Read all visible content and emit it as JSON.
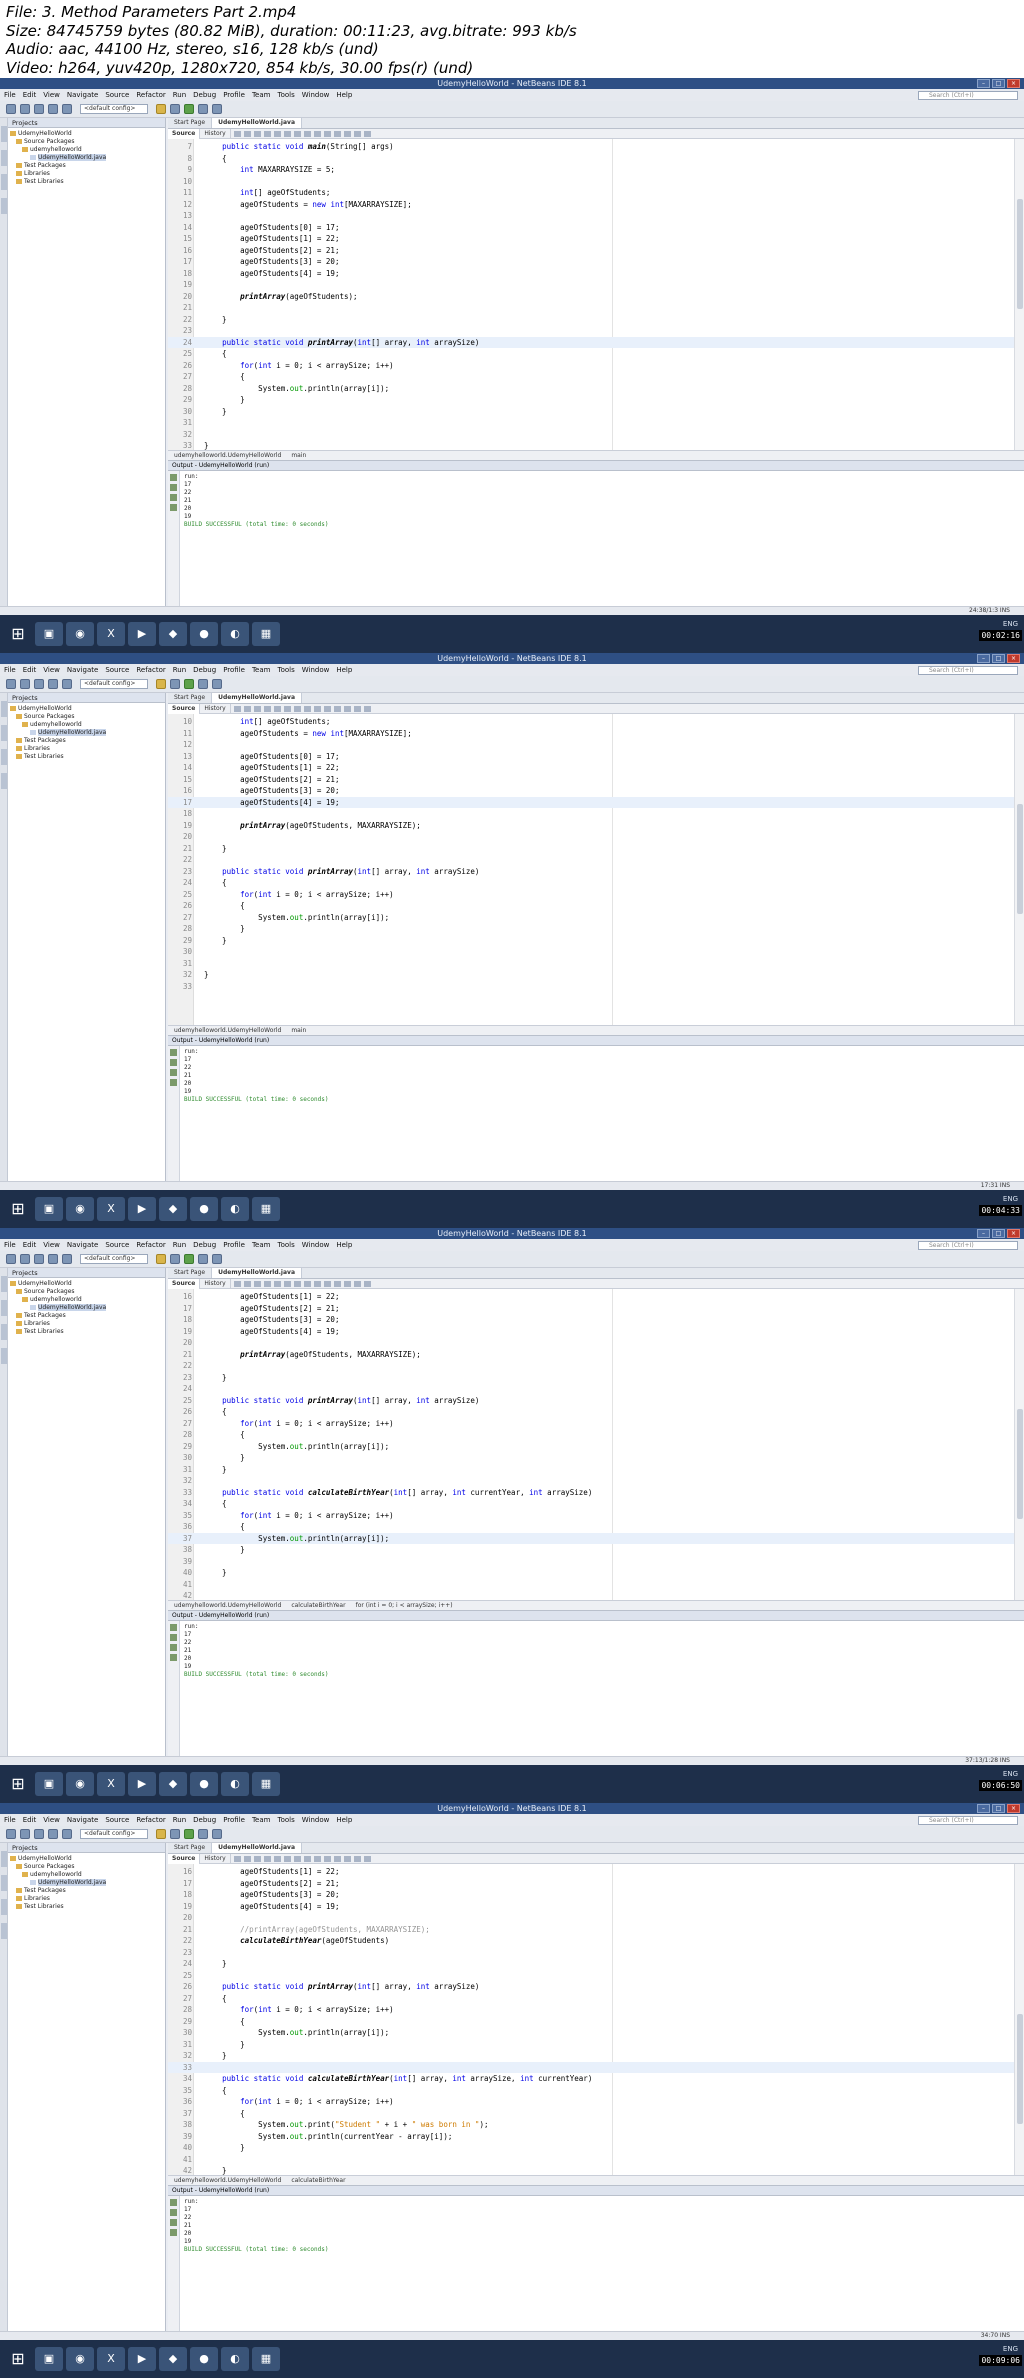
{
  "header": {
    "file_line": "File: 3. Method Parameters Part 2.mp4",
    "size_line": "Size: 84745759 bytes (80.82 MiB), duration: 00:11:23, avg.bitrate: 993 kb/s",
    "audio_line": "Audio: aac, 44100 Hz, stereo, s16, 128 kb/s (und)",
    "video_line": "Video: h264, yuv420p, 1280x720, 854 kb/s, 30.00 fps(r) (und)"
  },
  "ide": {
    "window_title": "UdemyHelloWorld - NetBeans IDE 8.1",
    "menu": [
      "File",
      "Edit",
      "View",
      "Navigate",
      "Source",
      "Refactor",
      "Run",
      "Debug",
      "Profile",
      "Team",
      "Tools",
      "Window",
      "Help"
    ],
    "search_placeholder": "Search (Ctrl+I)",
    "config": "<default config>",
    "projects_tab": "Projects",
    "tree": [
      "UdemyHelloWorld",
      "Source Packages",
      "udemyhelloworld",
      "UdemyHelloWorld.java",
      "Test Packages",
      "Libraries",
      "Test Libraries"
    ],
    "editor_tabs": [
      "Start Page",
      "UdemyHelloWorld.java"
    ],
    "source_btn": "Source",
    "history_btn": "History",
    "output_tab": "Output - UdemyHelloWorld (run)",
    "taskbar_apps": [
      "⊞",
      "▣",
      "◉",
      "X",
      "▶",
      "◆",
      "●",
      "◐",
      "▦"
    ],
    "tray_lang": "ENG"
  },
  "frames": [
    {
      "timestamp": "00:02:16",
      "first_line_no": 7,
      "highlight_line": 24,
      "lines": [
        "    public static void main(String[] args)",
        "    {",
        "        int MAXARRAYSIZE = 5;",
        "",
        "        int[] ageOfStudents;",
        "        ageOfStudents = new int[MAXARRAYSIZE];",
        "",
        "        ageOfStudents[0] = 17;",
        "        ageOfStudents[1] = 22;",
        "        ageOfStudents[2] = 21;",
        "        ageOfStudents[3] = 20;",
        "        ageOfStudents[4] = 19;",
        "",
        "        printArray(ageOfStudents);",
        "",
        "    }",
        "",
        "    public static void printArray(int[] array, int arraySize)",
        "    {",
        "        for(int i = 0; i < arraySize; i++)",
        "        {",
        "            System.out.println(array[i]);",
        "        }",
        "    }",
        "",
        "",
        "}",
        ""
      ],
      "nav": [
        "udemyhelloworld.UdemyHelloWorld",
        "main"
      ],
      "output": [
        "run:",
        "17",
        "22",
        "21",
        "20",
        "19",
        "BUILD SUCCESSFUL (total time: 0 seconds)"
      ],
      "status": "24:38/1:3  INS"
    },
    {
      "timestamp": "00:04:33",
      "first_line_no": 10,
      "highlight_line": 17,
      "lines": [
        "        int[] ageOfStudents;",
        "        ageOfStudents = new int[MAXARRAYSIZE];",
        "",
        "        ageOfStudents[0] = 17;",
        "        ageOfStudents[1] = 22;",
        "        ageOfStudents[2] = 21;",
        "        ageOfStudents[3] = 20;",
        "        ageOfStudents[4] = 19;",
        "",
        "        printArray(ageOfStudents, MAXARRAYSIZE);",
        "",
        "    }",
        "",
        "    public static void printArray(int[] array, int arraySize)",
        "    {",
        "        for(int i = 0; i < arraySize; i++)",
        "        {",
        "            System.out.println(array[i]);",
        "        }",
        "    }",
        "",
        "",
        "}",
        ""
      ],
      "nav": [
        "udemyhelloworld.UdemyHelloWorld",
        "main"
      ],
      "output": [
        "run:",
        "17",
        "22",
        "21",
        "20",
        "19",
        "BUILD SUCCESSFUL (total time: 0 seconds)"
      ],
      "status": "17:31  INS"
    },
    {
      "timestamp": "00:06:50",
      "first_line_no": 16,
      "highlight_line": 37,
      "lines": [
        "        ageOfStudents[1] = 22;",
        "        ageOfStudents[2] = 21;",
        "        ageOfStudents[3] = 20;",
        "        ageOfStudents[4] = 19;",
        "",
        "        printArray(ageOfStudents, MAXARRAYSIZE);",
        "",
        "    }",
        "",
        "    public static void printArray(int[] array, int arraySize)",
        "    {",
        "        for(int i = 0; i < arraySize; i++)",
        "        {",
        "            System.out.println(array[i]);",
        "        }",
        "    }",
        "",
        "    public static void calculateBirthYear(int[] array, int currentYear, int arraySize)",
        "    {",
        "        for(int i = 0; i < arraySize; i++)",
        "        {",
        "            System.out.println(array[i]);",
        "        }",
        "",
        "    }",
        "",
        "",
        "}",
        ""
      ],
      "nav": [
        "udemyhelloworld.UdemyHelloWorld",
        "calculateBirthYear",
        "for (int i = 0; i < arraySize; i++)"
      ],
      "output": [
        "run:",
        "17",
        "22",
        "21",
        "20",
        "19",
        "BUILD SUCCESSFUL (total time: 0 seconds)"
      ],
      "status": "37:13/1:28  INS"
    },
    {
      "timestamp": "00:09:06",
      "first_line_no": 16,
      "highlight_line": 33,
      "lines": [
        "        ageOfStudents[1] = 22;",
        "        ageOfStudents[2] = 21;",
        "        ageOfStudents[3] = 20;",
        "        ageOfStudents[4] = 19;",
        "",
        "        //printArray(ageOfStudents, MAXARRAYSIZE);",
        "        calculateBirthYear(ageOfStudents)",
        "",
        "    }",
        "",
        "    public static void printArray(int[] array, int arraySize)",
        "    {",
        "        for(int i = 0; i < arraySize; i++)",
        "        {",
        "            System.out.println(array[i]);",
        "        }",
        "    }",
        "",
        "    public static void calculateBirthYear(int[] array, int arraySize, int currentYear)",
        "    {",
        "        for(int i = 0; i < arraySize; i++)",
        "        {",
        "            System.out.print(\"Student \" + i + \" was born in \");",
        "            System.out.println(currentYear - array[i]);",
        "        }",
        "",
        "    }",
        "",
        "",
        "}",
        ""
      ],
      "nav": [
        "udemyhelloworld.UdemyHelloWorld",
        "calculateBirthYear"
      ],
      "output": [
        "run:",
        "17",
        "22",
        "21",
        "20",
        "19",
        "BUILD SUCCESSFUL (total time: 0 seconds)"
      ],
      "status": "34:70  INS"
    }
  ]
}
